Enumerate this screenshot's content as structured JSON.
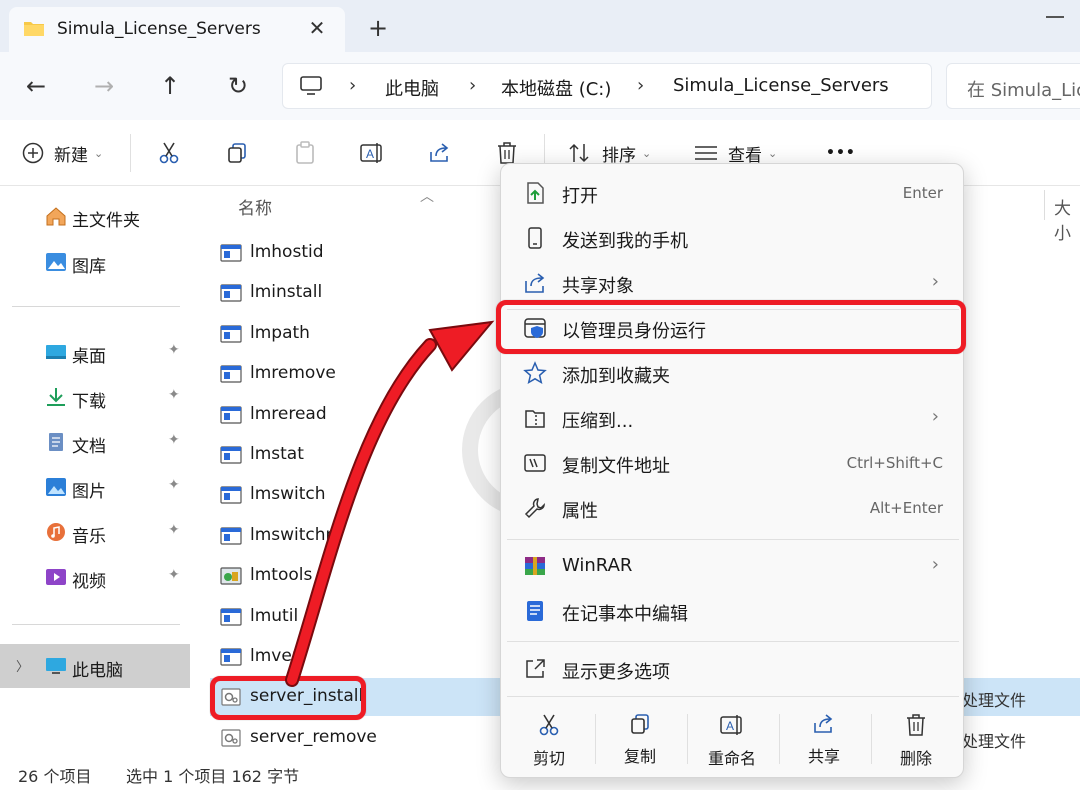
{
  "tab": {
    "title": "Simula_License_Servers",
    "close": "✕",
    "new_tab": "+"
  },
  "nav": {
    "back": "←",
    "forward": "→",
    "up": "↑",
    "refresh": "↻",
    "breadcrumbs": [
      "此电脑",
      "本地磁盘 (C:)",
      "Simula_License_Servers"
    ],
    "separator": "›",
    "search_placeholder": "在 Simula_License_Servers"
  },
  "toolbar": {
    "new_label": "新建",
    "sort_label": "排序",
    "view_label": "查看",
    "more": "•••"
  },
  "sidebar": {
    "home": "主文件夹",
    "gallery": "图库",
    "quick": [
      {
        "label": "桌面",
        "icon": "desktop-icon"
      },
      {
        "label": "下载",
        "icon": "download-icon"
      },
      {
        "label": "文档",
        "icon": "document-icon"
      },
      {
        "label": "图片",
        "icon": "pictures-icon"
      },
      {
        "label": "音乐",
        "icon": "music-icon"
      },
      {
        "label": "视频",
        "icon": "video-icon"
      }
    ],
    "thispc": "此电脑",
    "pin": "📌"
  },
  "filelist": {
    "col_name": "名称",
    "col_size": "大小",
    "files": [
      {
        "name": "lmhostid",
        "type": ""
      },
      {
        "name": "lminstall",
        "type": ""
      },
      {
        "name": "lmpath",
        "type": ""
      },
      {
        "name": "lmremove",
        "type": ""
      },
      {
        "name": "lmreread",
        "type": ""
      },
      {
        "name": "lmstat",
        "type": ""
      },
      {
        "name": "lmswitch",
        "type": ""
      },
      {
        "name": "lmswitchr",
        "type": ""
      },
      {
        "name": "lmtools",
        "type": ""
      },
      {
        "name": "lmutil",
        "type": ""
      },
      {
        "name": "lmver",
        "type": ""
      },
      {
        "name": "server_install",
        "type": "处理文件"
      },
      {
        "name": "server_remove",
        "type": "处理文件"
      }
    ]
  },
  "statusbar": {
    "count": "26 个项目",
    "selection": "选中 1 个项目  162 字节"
  },
  "context_menu": {
    "items": [
      {
        "label": "打开",
        "shortcut": "Enter",
        "icon": "open-icon"
      },
      {
        "label": "发送到我的手机",
        "icon": "phone-icon"
      },
      {
        "label": "共享对象",
        "icon": "share-icon",
        "arrow": "›"
      },
      {
        "label": "以管理员身份运行",
        "icon": "admin-shield-icon"
      },
      {
        "label": "添加到收藏夹",
        "icon": "star-icon"
      },
      {
        "label": "压缩到...",
        "icon": "zip-icon",
        "arrow": "›"
      },
      {
        "label": "复制文件地址",
        "shortcut": "Ctrl+Shift+C",
        "icon": "copy-path-icon"
      },
      {
        "label": "属性",
        "shortcut": "Alt+Enter",
        "icon": "wrench-icon"
      },
      {
        "label": "WinRAR",
        "icon": "winrar-icon",
        "arrow": "›"
      },
      {
        "label": "在记事本中编辑",
        "icon": "notepad-icon"
      },
      {
        "label": "显示更多选项",
        "icon": "more-options-icon"
      }
    ],
    "quick_actions": [
      "剪切",
      "复制",
      "重命名",
      "共享",
      "删除"
    ]
  },
  "colors": {
    "highlight": "#ee1c25",
    "selection": "#cce4f7",
    "accent": "#1a73e8"
  }
}
